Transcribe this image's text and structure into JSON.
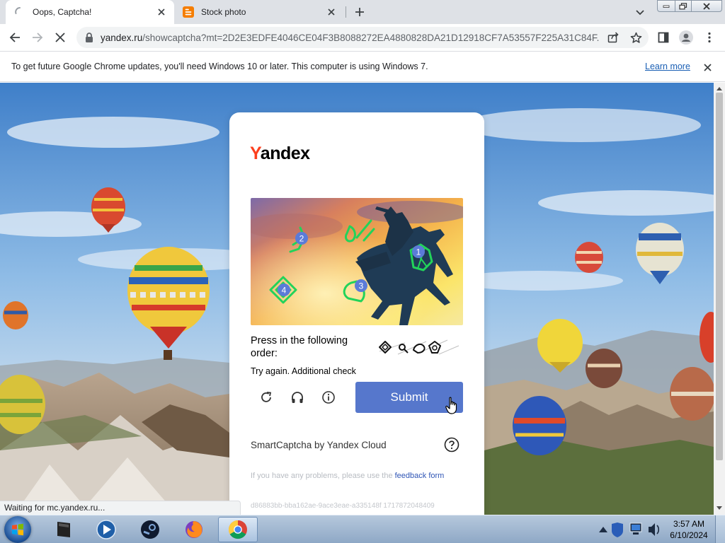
{
  "browser": {
    "tabs": [
      {
        "title": "Oops, Captcha!",
        "active": true
      },
      {
        "title": "Stock photo",
        "active": false
      }
    ],
    "url_host": "yandex.ru",
    "url_rest": "/showcaptcha?mt=2D2E3EDFE4046CE04F3B8088272EA4880828DA21D12918CF7A53557F225A31C84F...",
    "infobar": {
      "message": "To get future Google Chrome updates, you'll need Windows 10 or later. This computer is using Windows 7.",
      "link": "Learn more"
    },
    "status_text": "Waiting for mc.yandex.ru..."
  },
  "captcha": {
    "logo_first": "Y",
    "logo_rest": "andex",
    "prompt": "Press in the following order:",
    "error": "Try again. Additional check",
    "submit_label": "Submit",
    "brand": "SmartCaptcha by Yandex Cloud",
    "problems_text": "If you have any problems, please use the ",
    "feedback_link": "feedback form",
    "request_id": "d86883bb-bba162ae-9ace3eae-a335148f 1717872048409",
    "markers": [
      "1",
      "2",
      "3",
      "4"
    ]
  },
  "taskbar": {
    "time": "3:57 AM",
    "date": "6/10/2024",
    "apps": [
      "file-manager-icon",
      "media-player-icon",
      "steam-icon",
      "firefox-icon",
      "chrome-icon"
    ]
  },
  "colors": {
    "yandex_red": "#fc3f1d",
    "submit_blue": "#5677cc",
    "link_blue": "#1a5fb4",
    "marker_green": "#22d35a",
    "marker_badge": "#5b7bd8"
  }
}
